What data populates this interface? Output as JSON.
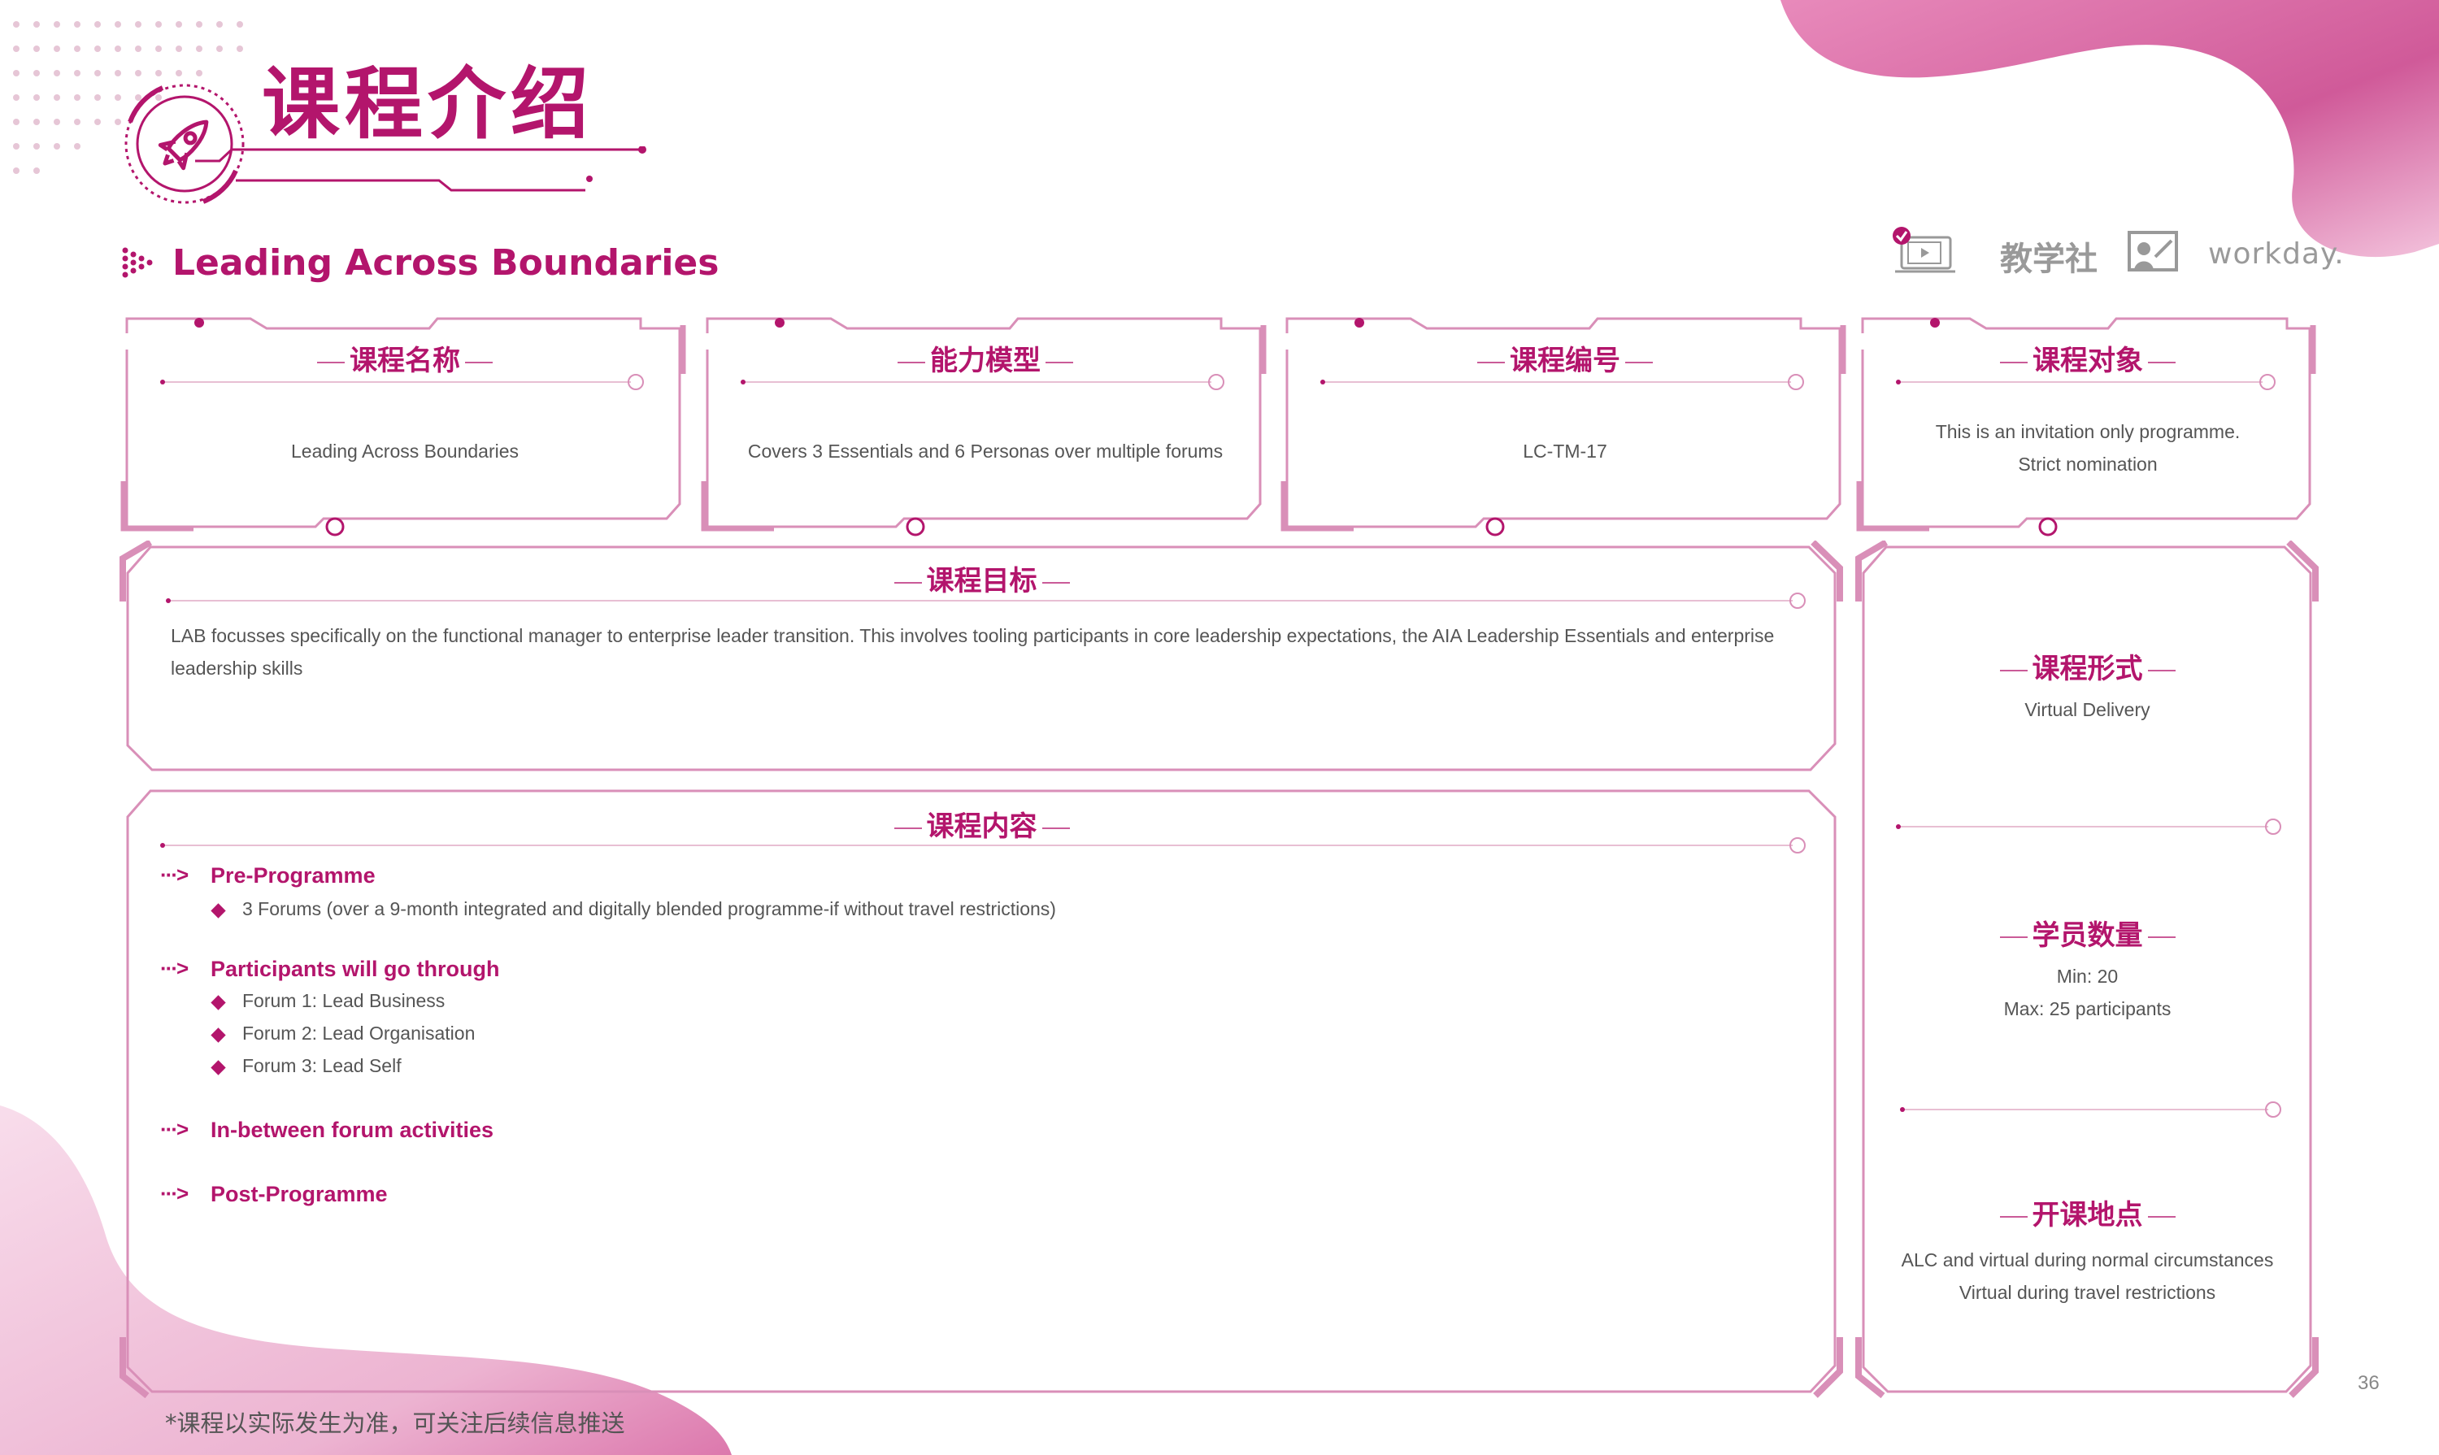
{
  "header": {
    "title": "课程介绍",
    "subtitle": "Leading Across Boundaries"
  },
  "logos": [
    "video-check-icon",
    "教学社",
    "whiteboard-icon",
    "workday."
  ],
  "cards": {
    "name": {
      "heading": "课程名称",
      "value": "Leading Across Boundaries"
    },
    "competency": {
      "heading": "能力模型",
      "value": "Covers 3 Essentials and 6 Personas over multiple forums"
    },
    "code": {
      "heading": "课程编号",
      "value": "LC-TM-17"
    },
    "audience": {
      "heading": "课程对象",
      "line1": "This is an invitation only programme.",
      "line2": "Strict nomination"
    }
  },
  "goal": {
    "heading": "课程目标",
    "text": "LAB focusses specifically on the functional manager to enterprise leader transition. This involves tooling participants in core leadership expectations, the AIA Leadership Essentials and enterprise leadership skills"
  },
  "content": {
    "heading": "课程内容",
    "sections": [
      {
        "title": "Pre-Programme",
        "items": [
          "3 Forums (over a 9-month integrated and digitally blended programme-if without travel restrictions)"
        ]
      },
      {
        "title": "Participants will go through",
        "items": [
          "Forum 1: Lead Business",
          "Forum 2: Lead Organisation",
          "Forum 3: Lead Self"
        ]
      },
      {
        "title": "In-between forum activities",
        "items": []
      },
      {
        "title": "Post-Programme",
        "items": []
      }
    ]
  },
  "side": {
    "format": {
      "heading": "课程形式",
      "value": "Virtual Delivery"
    },
    "size": {
      "heading": "学员数量",
      "line1": "Min: 20",
      "line2": "Max: 25 participants"
    },
    "location": {
      "heading": "开课地点",
      "line1": "ALC and virtual during normal circumstances",
      "line2": "Virtual during travel restrictions"
    }
  },
  "footer": {
    "note": "*课程以实际发生为准，可关注后续信息推送",
    "page_number": "36"
  },
  "colors": {
    "accent": "#b3156c",
    "frame": "#d98fb8",
    "blob": "#d6609e"
  }
}
